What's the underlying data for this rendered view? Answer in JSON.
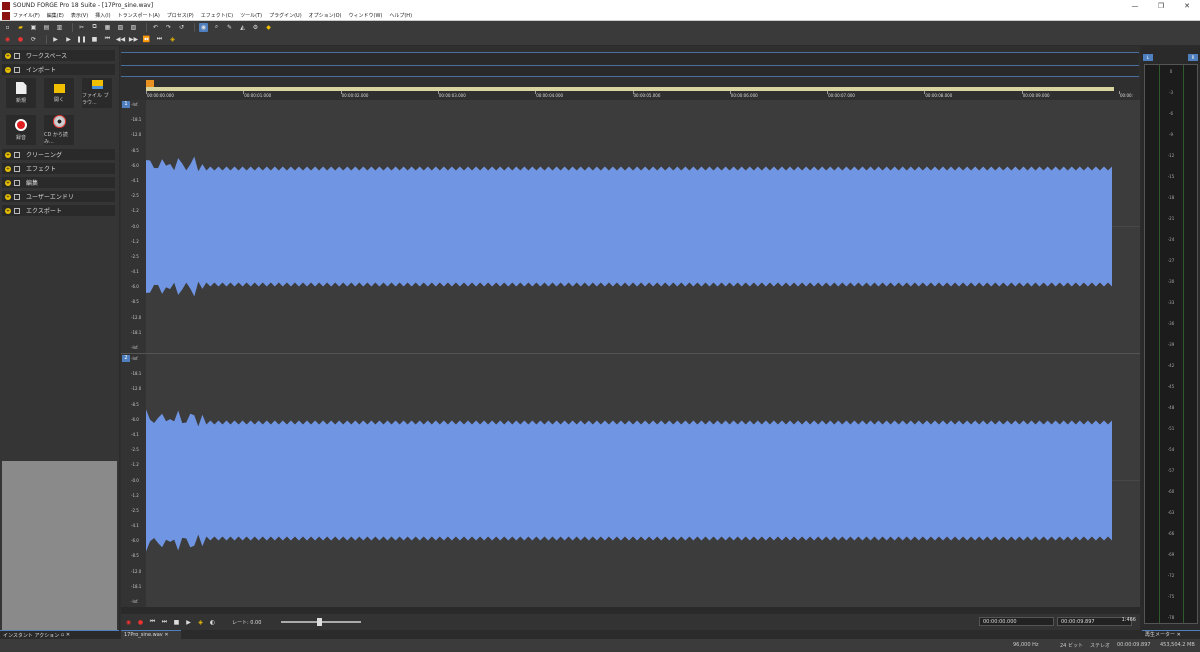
{
  "window": {
    "title": "SOUND FORGE Pro 18 Suite - [17Pro_sine.wav]",
    "controls": [
      "—",
      "❐",
      "✕"
    ]
  },
  "menu": [
    "ファイル(F)",
    "編集(E)",
    "表示(V)",
    "挿入(I)",
    "トランスポート(A)",
    "プロセス(P)",
    "エフェクト(C)",
    "ツール(T)",
    "プラグイン(U)",
    "オプション(O)",
    "ウィンドウ(W)",
    "ヘルプ(H)"
  ],
  "left_panel": {
    "sections": [
      {
        "label": "ワークスペース"
      },
      {
        "label": "インポート"
      },
      {
        "label": "クリーニング"
      },
      {
        "label": "エフェクト"
      },
      {
        "label": "編集"
      },
      {
        "label": "ユーザーエンドリ"
      },
      {
        "label": "エクスポート"
      }
    ],
    "import_tiles": [
      {
        "label": "新規"
      },
      {
        "label": "開く"
      },
      {
        "label": "ファイル ブラウ..."
      },
      {
        "label": "録音"
      },
      {
        "label": "CD から読み..."
      }
    ],
    "tab_label": "インスタント アクション"
  },
  "channels": [
    {
      "number": "1",
      "db_labels": [
        "-Inf.",
        "-18.1",
        "-12.0",
        "-8.5",
        "-6.0",
        "-4.1",
        "-2.5",
        "-1.2",
        "-0.0",
        "-1.2",
        "-2.5",
        "-4.1",
        "-6.0",
        "-8.5",
        "-12.0",
        "-18.1",
        "-Inf."
      ]
    },
    {
      "number": "2",
      "db_labels": [
        "-Inf.",
        "-18.1",
        "-12.0",
        "-8.5",
        "-6.0",
        "-4.1",
        "-2.5",
        "-1.2",
        "-0.0",
        "-1.2",
        "-2.5",
        "-4.1",
        "-6.0",
        "-8.5",
        "-12.0",
        "-18.1",
        "-Inf."
      ]
    }
  ],
  "time_ruler": [
    "00:00:00.000",
    "00:00:01.000",
    "00:00:02.000",
    "00:00:03.000",
    "00:00:04.000",
    "00:00:05.000",
    "00:00:06.000",
    "00:00:07.000",
    "00:00:08.000",
    "00:00:09.000",
    "00:00:"
  ],
  "transport": {
    "rate_label": "レート: 0.00",
    "selection_start": "00:00:00.000",
    "selection_end": "00:00:09.897",
    "zoom": "1:466"
  },
  "document_tab": "17Pro_sine.wav",
  "meter": {
    "title": "再生メーター",
    "channel_labels": [
      "L",
      "R"
    ],
    "scale": [
      "0",
      "-3",
      "-6",
      "-9",
      "-12",
      "-15",
      "-18",
      "-21",
      "-24",
      "-27",
      "-30",
      "-33",
      "-36",
      "-39",
      "-42",
      "-45",
      "-48",
      "-51",
      "-54",
      "-57",
      "-60",
      "-63",
      "-66",
      "-69",
      "-72",
      "-75",
      "-78"
    ]
  },
  "status": {
    "sample_rate": "96,000 Hz",
    "bit_depth": "24 ビット",
    "channels": "ステレオ",
    "length": "00:00:09.897",
    "free_space": "453,504.2 MB"
  },
  "colors": {
    "waveform": "#7095e2",
    "accent": "#4f7fbf",
    "ruler": "#d8d5a0"
  }
}
